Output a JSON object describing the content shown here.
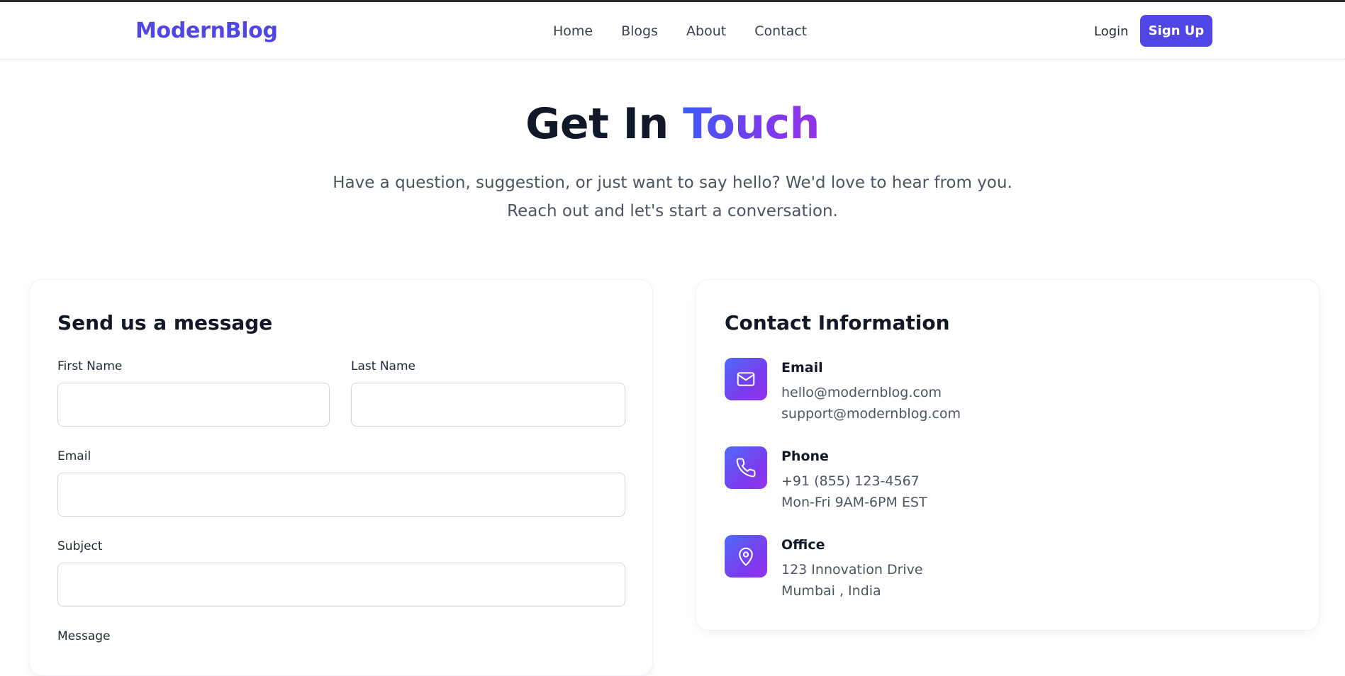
{
  "nav": {
    "logo": "ModernBlog",
    "links": [
      "Home",
      "Blogs",
      "About",
      "Contact"
    ],
    "login": "Login",
    "signup": "Sign Up"
  },
  "hero": {
    "title_main": "Get In",
    "title_accent": "Touch",
    "subtitle_line1": "Have a question, suggestion, or just want to say hello? We'd love to hear from you.",
    "subtitle_line2": "Reach out and let's start a conversation."
  },
  "form": {
    "title": "Send us a message",
    "first_name_label": "First Name",
    "last_name_label": "Last Name",
    "email_label": "Email",
    "subject_label": "Subject",
    "message_label": "Message"
  },
  "contact": {
    "title": "Contact Information",
    "items": [
      {
        "heading": "Email",
        "line1": "hello@modernblog.com",
        "line2": "support@modernblog.com",
        "icon": "mail-icon"
      },
      {
        "heading": "Phone",
        "line1": "+91 (855) 123-4567",
        "line2": "Mon-Fri 9AM-6PM EST",
        "icon": "phone-icon"
      },
      {
        "heading": "Office",
        "line1": "123 Innovation Drive",
        "line2": "Mumbai , India",
        "icon": "map-pin-icon"
      }
    ]
  },
  "colors": {
    "brand": "#4f46e5",
    "gradient_start": "#3b5bf6",
    "gradient_end": "#9333ea",
    "text_dark": "#111827",
    "text_muted": "#4b5563"
  }
}
